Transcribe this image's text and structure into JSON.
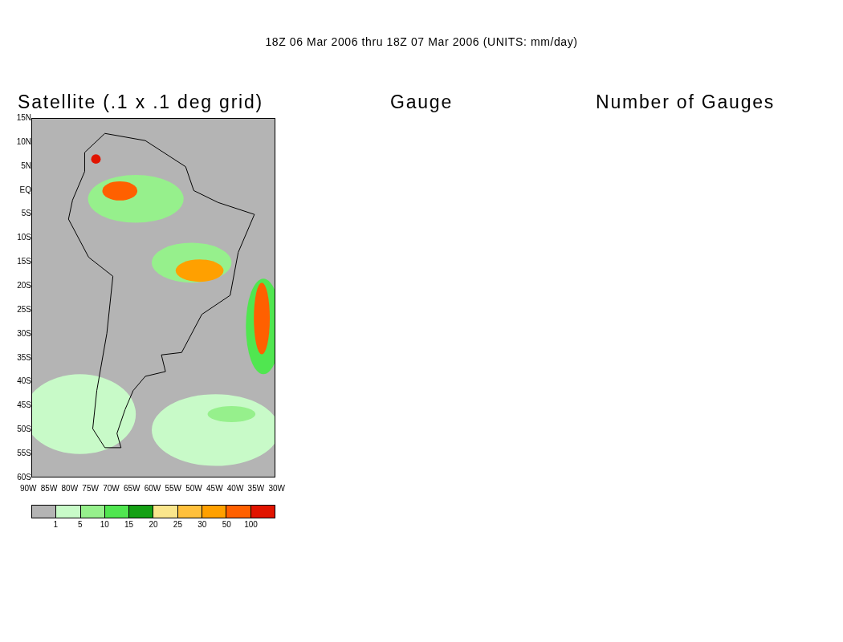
{
  "title": "18Z 06 Mar 2006 thru 18Z 07 Mar 2006 (UNITS: mm/day)",
  "panels": [
    {
      "title": "Satellite (.1 x .1 deg grid)",
      "kind": "map"
    },
    {
      "title": "Gauge",
      "kind": "empty"
    },
    {
      "title": "Number of Gauges",
      "kind": "empty"
    }
  ],
  "lat_labels": [
    "15N",
    "10N",
    "5N",
    "EQ",
    "5S",
    "10S",
    "15S",
    "20S",
    "25S",
    "30S",
    "35S",
    "40S",
    "45S",
    "50S",
    "55S",
    "60S"
  ],
  "lon_labels": [
    "90W",
    "85W",
    "80W",
    "75W",
    "70W",
    "65W",
    "60W",
    "55W",
    "50W",
    "45W",
    "40W",
    "35W",
    "30W"
  ],
  "legend": {
    "swatches": [
      {
        "color": "#b4b4b4"
      },
      {
        "color": "#c8fac8"
      },
      {
        "color": "#96f08c"
      },
      {
        "color": "#50e650"
      },
      {
        "color": "#14a014"
      },
      {
        "color": "#fae68c"
      },
      {
        "color": "#ffc03c"
      },
      {
        "color": "#ffa000"
      },
      {
        "color": "#ff6000"
      },
      {
        "color": "#e11400"
      }
    ],
    "labels": [
      "1",
      "5",
      "10",
      "15",
      "20",
      "25",
      "30",
      "50",
      "100"
    ]
  }
}
